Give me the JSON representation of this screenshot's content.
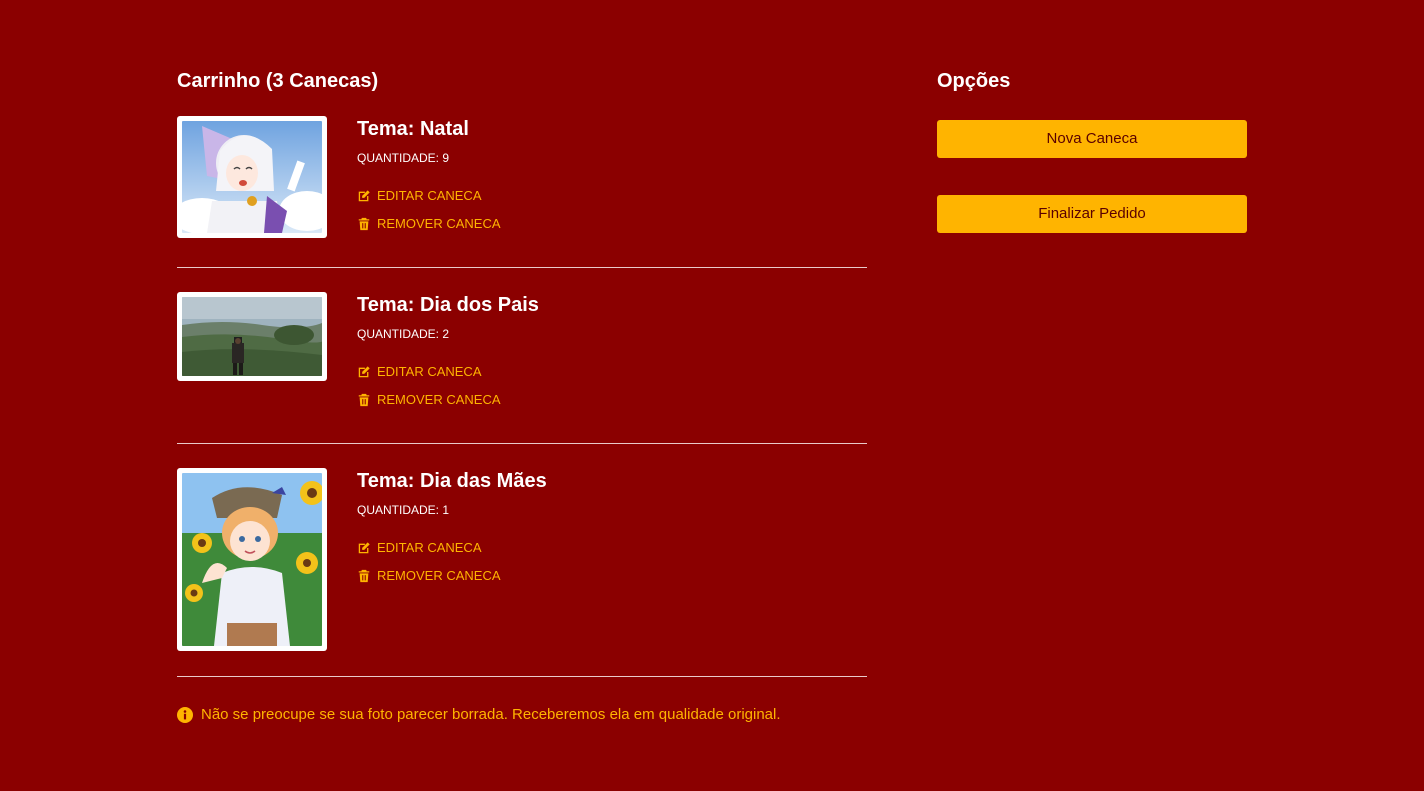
{
  "cart": {
    "title": "Carrinho (3 Canecas)",
    "items": [
      {
        "theme": "Tema: Natal",
        "quantity": "QUANTIDADE: 9",
        "edit_label": "EDITAR CANECA",
        "remove_label": "REMOVER CANECA"
      },
      {
        "theme": "Tema: Dia dos Pais",
        "quantity": "QUANTIDADE: 2",
        "edit_label": "EDITAR CANECA",
        "remove_label": "REMOVER CANECA"
      },
      {
        "theme": "Tema: Dia das Mães",
        "quantity": "QUANTIDADE: 1",
        "edit_label": "EDITAR CANECA",
        "remove_label": "REMOVER CANECA"
      }
    ],
    "notice": "Não se preocupe se sua foto parecer borrada. Receberemos ela em qualidade original."
  },
  "options": {
    "title": "Opções",
    "new_mug_label": "Nova Caneca",
    "checkout_label": "Finalizar Pedido"
  },
  "colors": {
    "background": "#8b0000",
    "accent": "#ffb400",
    "button_text": "#5a0000"
  },
  "icons": {
    "edit": "edit-icon",
    "remove": "trash-icon",
    "info": "info-circle-icon"
  }
}
